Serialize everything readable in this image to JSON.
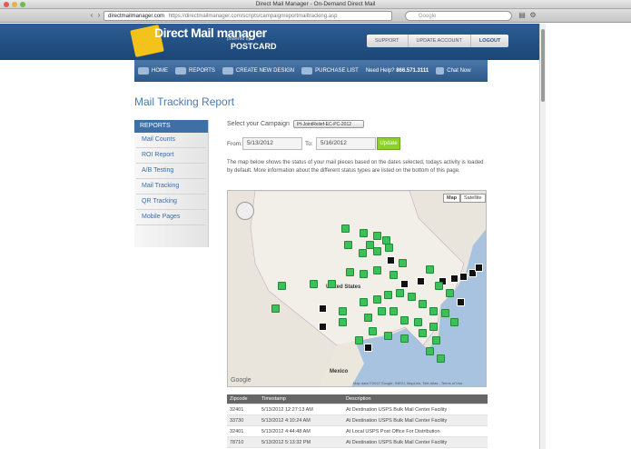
{
  "window": {
    "title": "Direct Mail Manager - On-Demand Direct Mail"
  },
  "browser": {
    "url_host": "directmailmanager.com",
    "url_full": "https://directmailmanager.com/scripts/campaignreportmailtracking.asp",
    "search_placeholder": "Google"
  },
  "brand": {
    "name": "Direct Mail manager",
    "powered_by": "powered by",
    "partner": "POSTCARD"
  },
  "top_nav": [
    "SUPPORT",
    "UPDATE ACCOUNT",
    "LOGOUT"
  ],
  "main_nav": {
    "home": "HOME",
    "reports": "REPORTS",
    "create": "CREATE NEW DESIGN",
    "purchase": "PURCHASE LIST",
    "help_label": "Need Help?",
    "help_phone": "866.571.3111",
    "chat": "Chat Now"
  },
  "page_title": "Mail Tracking Report",
  "sidebar": {
    "header": "REPORTS",
    "items": [
      "Mail Counts",
      "ROI Report",
      "A/B Testing",
      "Mail Tracking",
      "QR Tracking",
      "Mobile Pages"
    ]
  },
  "form": {
    "campaign_label": "Select your Campaign",
    "campaign_value": "IH-JointRelief-EC-PC-2012",
    "from_label": "From:",
    "from_value": "5/13/2012",
    "to_label": "To:",
    "to_value": "5/16/2012",
    "update_label": "Update"
  },
  "description": "The map below shows the status of your mail pieces based on the dates selected, todays activity is loaded by default. More information about the different status types are listed on the bottom of this page.",
  "map": {
    "map_btn": "Map",
    "satellite_btn": "Satellite",
    "country_us": "United States",
    "country_mx": "Mexico",
    "attribution": "Map data ©2012 Google, INEGI, MapLink, Tele Atlas - Terms of Use",
    "google": "Google",
    "colors": {
      "delivered": "#3cc15a",
      "in_transit": "#111111"
    }
  },
  "table": {
    "headers": [
      "Zipcode",
      "Timestamp",
      "Description"
    ],
    "rows": [
      [
        "32401",
        "5/13/2012 12:27:13 AM",
        "At Destination USPS Bulk Mail Center Facility"
      ],
      [
        "33730",
        "5/13/2012 4:10:24 AM",
        "At Destination USPS Bulk Mail Center Facility"
      ],
      [
        "32401",
        "5/13/2012 4:44:48 AM",
        "At Local USPS Post Office For Distribution"
      ],
      [
        "78710",
        "5/13/2012 5:13:32 PM",
        "At Destination USPS Bulk Mail Center Facility"
      ]
    ]
  }
}
